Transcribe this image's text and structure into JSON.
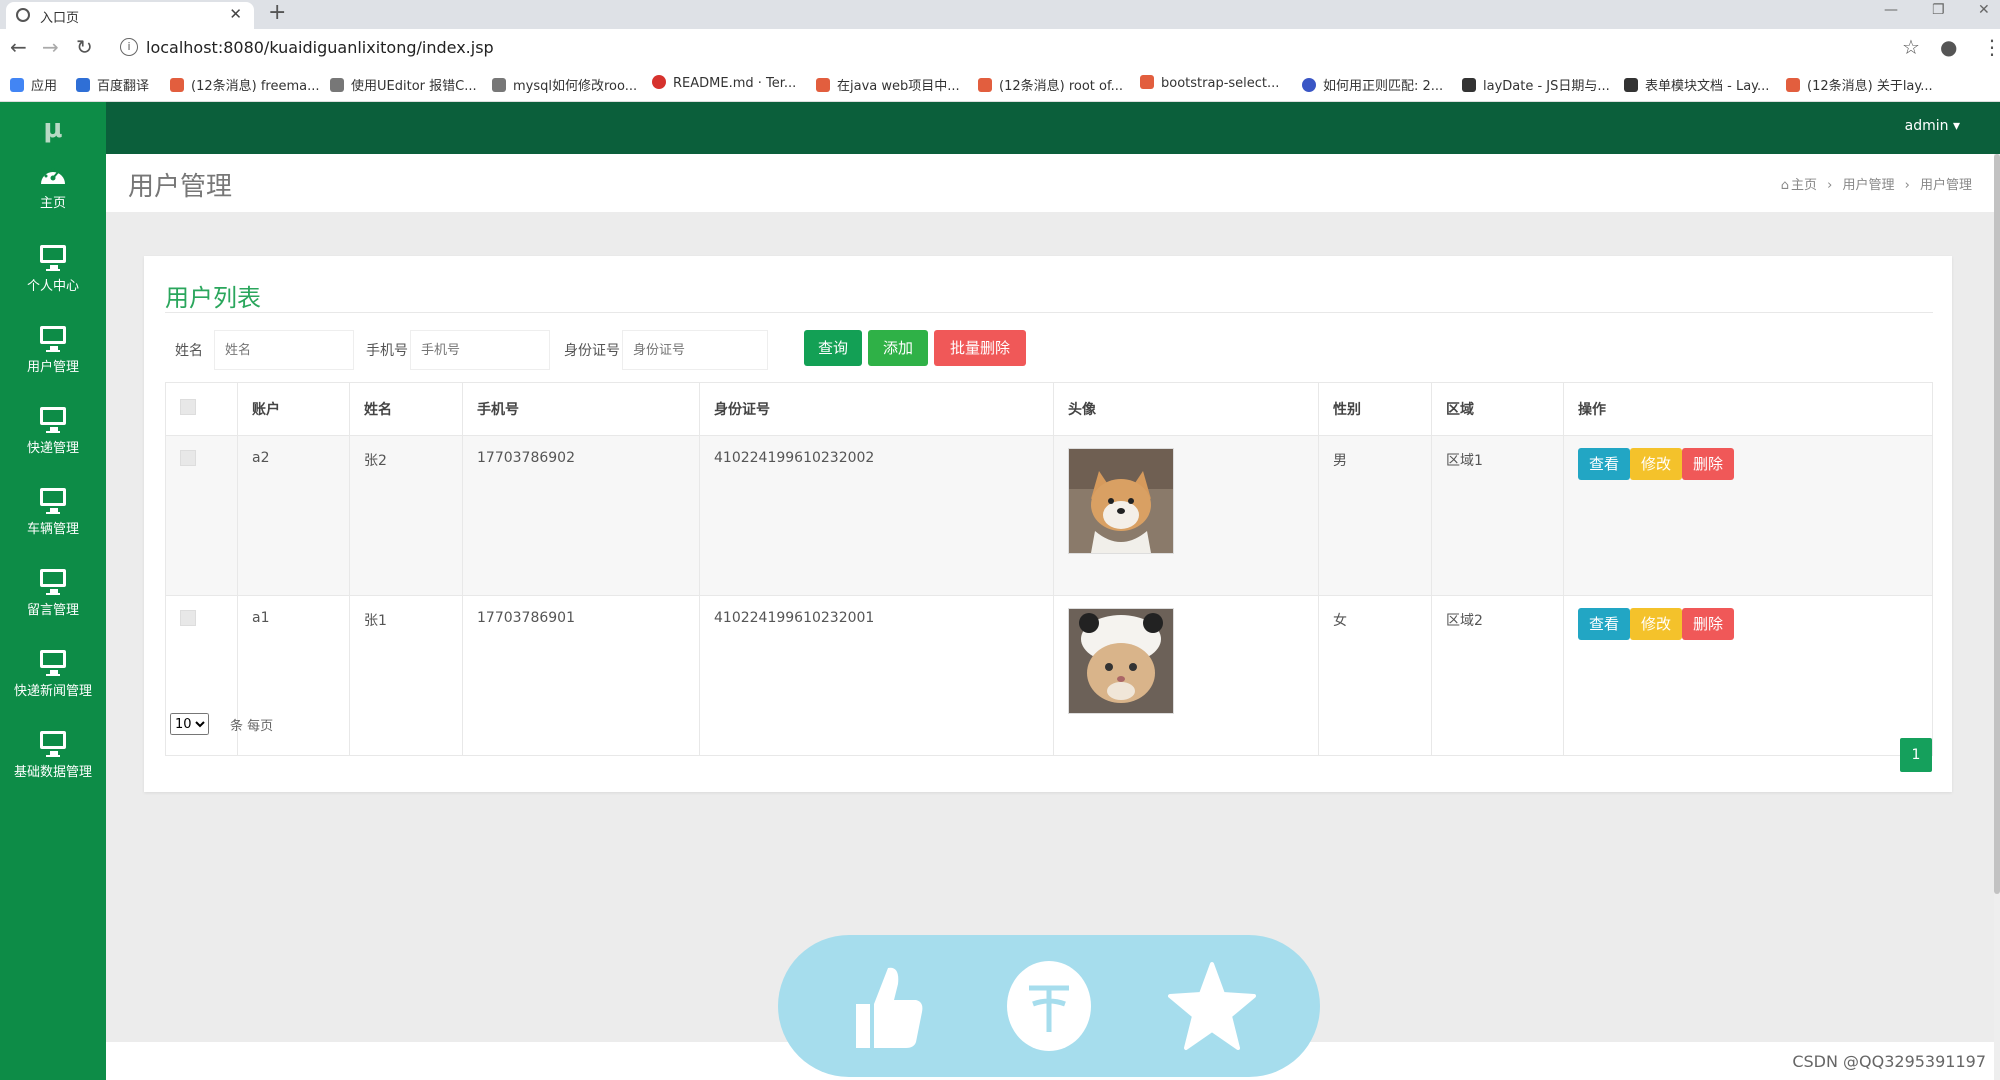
{
  "browser": {
    "tab_title": "入口页",
    "tab_close": "✕",
    "new_tab": "+",
    "url": "localhost:8080/kuaidiguanlixitong/index.jsp",
    "bookmarks": [
      {
        "label": "应用",
        "color": "#4285f4"
      },
      {
        "label": "百度翻译",
        "color": "#2f6fd6"
      },
      {
        "label": "(12条消息) freema...",
        "color": "#e25e3e"
      },
      {
        "label": "使用UEditor 报错C...",
        "color": "#444444"
      },
      {
        "label": "mysql如何修改roo...",
        "color": "#444444"
      },
      {
        "label": "README.md · Ter...",
        "color": "#d6322d"
      },
      {
        "label": "在java web项目中...",
        "color": "#e25e3e"
      },
      {
        "label": "(12条消息) root of...",
        "color": "#e25e3e"
      },
      {
        "label": "bootstrap-select...",
        "color": "#e25e3e"
      },
      {
        "label": "如何用正则匹配: 2...",
        "color": "#3a56c5"
      },
      {
        "label": "layDate - JS日期与...",
        "color": "#333333"
      },
      {
        "label": "表单模块文档 - Lay...",
        "color": "#333333"
      },
      {
        "label": "(12条消息) 关于lay...",
        "color": "#e25e3e"
      }
    ]
  },
  "app": {
    "logo": "μ",
    "user_menu": "admin ▾",
    "sidebar": [
      {
        "label": "主页",
        "icon": "dashboard-icon"
      },
      {
        "label": "个人中心",
        "icon": "monitor-icon"
      },
      {
        "label": "用户管理",
        "icon": "monitor-icon"
      },
      {
        "label": "快递管理",
        "icon": "monitor-icon"
      },
      {
        "label": "车辆管理",
        "icon": "monitor-icon"
      },
      {
        "label": "留言管理",
        "icon": "monitor-icon"
      },
      {
        "label": "快递新闻管理",
        "icon": "monitor-icon"
      },
      {
        "label": "基础数据管理",
        "icon": "monitor-icon"
      }
    ],
    "page_title": "用户管理",
    "breadcrumb": [
      "主页",
      "用户管理",
      "用户管理"
    ],
    "breadcrumb_sep": "›"
  },
  "card": {
    "title": "用户列表",
    "filters": {
      "name_label": "姓名",
      "name_placeholder": "姓名",
      "phone_label": "手机号",
      "phone_placeholder": "手机号",
      "id_label": "身份证号",
      "id_placeholder": "身份证号"
    },
    "buttons": {
      "query": "查询",
      "add": "添加",
      "batch_delete": "批量删除"
    },
    "columns": [
      "账户",
      "姓名",
      "手机号",
      "身份证号",
      "头像",
      "性别",
      "区域",
      "操作"
    ],
    "rows": [
      {
        "account": "a2",
        "name": "张2",
        "phone": "17703786902",
        "id_number": "410224199610232002",
        "avatar": "shiba-dog-photo",
        "gender": "男",
        "region": "区域1"
      },
      {
        "account": "a1",
        "name": "张1",
        "phone": "17703786901",
        "id_number": "410224199610232001",
        "avatar": "cat-photo",
        "gender": "女",
        "region": "区域2"
      }
    ],
    "row_actions": {
      "view": "查看",
      "edit": "修改",
      "delete": "删除"
    },
    "page_size_options": [
      "10"
    ],
    "page_size_value": "10",
    "page_size_label": "条 每页",
    "current_page": "1"
  },
  "colors": {
    "sidebar": "#0d8c47",
    "topnav": "#0b5f3b",
    "btn_query": "#13a055",
    "btn_add": "#2fb147",
    "btn_danger": "#f05858",
    "btn_view": "#22a6c4",
    "btn_edit": "#f4c22b"
  },
  "watermark": "CSDN @QQ3295391197"
}
